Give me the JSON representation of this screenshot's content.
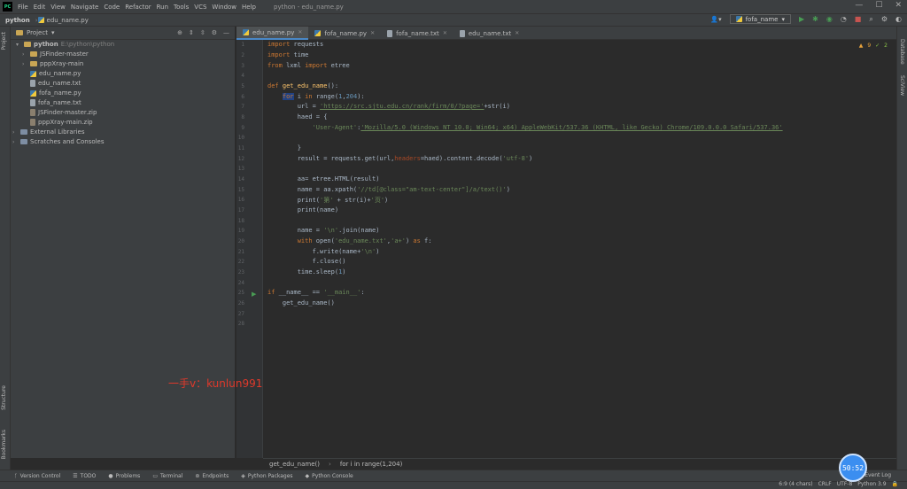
{
  "menubar": {
    "items": [
      "File",
      "Edit",
      "View",
      "Navigate",
      "Code",
      "Refactor",
      "Run",
      "Tools",
      "VCS",
      "Window",
      "Help"
    ],
    "window_title": "python - edu_name.py"
  },
  "navbar": {
    "project": "python",
    "file": "edu_name.py"
  },
  "toolbar": {
    "run_config": "fofa_name"
  },
  "project_panel": {
    "title": "Project",
    "tree": [
      {
        "label": "python",
        "extra": "E:\\python\\python",
        "type": "folder",
        "depth": 0,
        "expanded": true
      },
      {
        "label": "JSFinder-master",
        "type": "folder",
        "depth": 1
      },
      {
        "label": "pppXray-main",
        "type": "folder",
        "depth": 1
      },
      {
        "label": "edu_name.py",
        "type": "py",
        "depth": 1
      },
      {
        "label": "edu_name.txt",
        "type": "txt",
        "depth": 1
      },
      {
        "label": "fofa_name.py",
        "type": "py",
        "depth": 1
      },
      {
        "label": "fofa_name.txt",
        "type": "txt",
        "depth": 1
      },
      {
        "label": "JSFinder-master.zip",
        "type": "zip",
        "depth": 1
      },
      {
        "label": "pppXray-main.zip",
        "type": "zip",
        "depth": 1
      },
      {
        "label": "External Libraries",
        "type": "lib",
        "depth": 0
      },
      {
        "label": "Scratches and Consoles",
        "type": "lib",
        "depth": 0
      }
    ]
  },
  "tabs": [
    "edu_name.py",
    "fofa_name.py",
    "fofa_name.txt",
    "edu_name.txt"
  ],
  "inspections": {
    "warnings": "9",
    "ok": "2"
  },
  "code": {
    "line_numbers": [
      "1",
      "2",
      "3",
      "4",
      "5",
      "6",
      "7",
      "8",
      "9",
      "10",
      "11",
      "12",
      "13",
      "14",
      "15",
      "16",
      "17",
      "18",
      "19",
      "20",
      "21",
      "22",
      "23",
      "24",
      "25",
      "26",
      "27",
      "28"
    ],
    "l1_kw": "import",
    "l1_rest": " requests",
    "l2_kw": "import",
    "l2_rest": " time",
    "l3_kw1": "from",
    "l3_mid": " lxml ",
    "l3_kw2": "import",
    "l3_rest": " etree",
    "l5_kw": "def",
    "l5_fn": "get_edu_name",
    "l6_kw": "for",
    "l6_rest": " i ",
    "l6_kw2": "in",
    "l6_rest2": " range(",
    "l6_n1": "1",
    "l6_n2": "204",
    "l6_end": "):",
    "l7_a": "url = ",
    "l7_str": "'https://src.sjtu.edu.cn/rank/firm/0/?page='",
    "l7_b": "+str(i)",
    "l8": "haed = {",
    "l9_k": "'User-Agent'",
    "l9_v": "'Mozilla/5.0 (Windows NT 10.0; Win64; x64) AppleWebKit/537.36 (KHTML, like Gecko) Chrome/109.0.0.0 Safari/537.36'",
    "l11": "}",
    "l12_a": "result = requests.get(url,",
    "l12_p": "headers",
    "l12_b": "=haed).content.decode(",
    "l12_s": "'utf-8'",
    "l12_c": ")",
    "l14": "aa= etree.HTML(result)",
    "l15_a": "name = aa.xpath(",
    "l15_s": "'//td[@class=\"am-text-center\"]/a/text()'",
    "l15_b": ")",
    "l16_a": "print(",
    "l16_s1": "'第'",
    "l16_b": " + str(i)+",
    "l16_s2": "'页'",
    "l16_c": ")",
    "l17": "print(name)",
    "l19_a": "name = ",
    "l19_s": "'\\n'",
    "l19_b": ".join(name)",
    "l20_kw": "with",
    "l20_a": " open(",
    "l20_s1": "'edu_name.txt'",
    "l20_s2": "'a+'",
    "l20_b": ") ",
    "l20_kw2": "as",
    "l20_c": " f:",
    "l21_a": "f.write(name+",
    "l21_s": "'\\n'",
    "l21_b": ")",
    "l22": "f.close()",
    "l23_a": "time.sleep(",
    "l23_n": "1",
    "l23_b": ")",
    "l25_kw": "if",
    "l25_a": " __name__ == ",
    "l25_s": "'__main__'",
    "l25_b": ":",
    "l26": "get_edu_name()"
  },
  "breadcrumb": [
    "get_edu_name()",
    "for i in range(1,204)"
  ],
  "bottom_tools": [
    "Version Control",
    "TODO",
    "Problems",
    "Terminal",
    "Endpoints",
    "Python Packages",
    "Python Console"
  ],
  "status": {
    "position": "6:9 (4 chars)",
    "line_sep": "CRLF",
    "encoding": "UTF-8",
    "interpreter": "Python 3.9",
    "event_log": "Event Log"
  },
  "side_tabs": {
    "left_top": "Project",
    "left_structure": "Structure",
    "left_bookmarks": "Bookmarks",
    "right_database": "Database",
    "right_scview": "SciView"
  },
  "overlay": {
    "watermark": "一手v：kunlun991",
    "timer": "50:52"
  }
}
